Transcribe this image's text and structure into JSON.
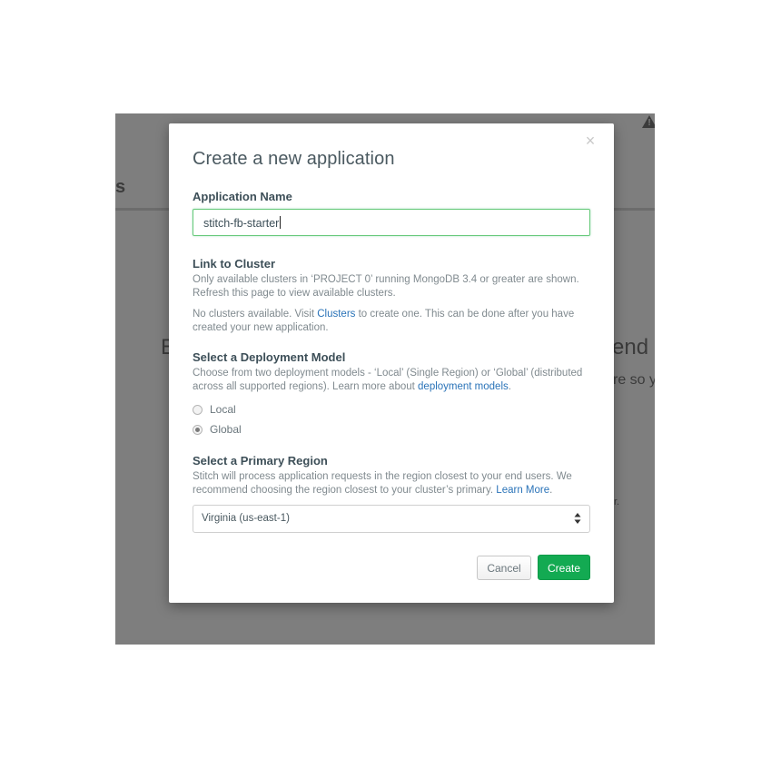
{
  "background": {
    "fragment_s": "s",
    "fragment_b": "E",
    "fragment_end": "end a",
    "fragment_so": "re so y",
    "fragment_r": "r."
  },
  "modal": {
    "close_symbol": "×",
    "title": "Create a new application",
    "app_name": {
      "label": "Application Name",
      "value": "stitch-fb-starter"
    },
    "cluster": {
      "label": "Link to Cluster",
      "help": "Only available clusters in ‘PROJECT 0’ running MongoDB 3.4 or greater are shown.  Refresh this page to view available clusters.",
      "note_before": "No clusters available. Visit ",
      "note_link": "Clusters",
      "note_after": " to create one. This can be done after you have created your new application."
    },
    "deployment": {
      "label": "Select a Deployment Model",
      "help_before": "Choose from two deployment models - ‘Local’ (Single Region) or ‘Global’ (distributed across all supported regions). Learn more about ",
      "help_link": "deployment models",
      "help_after": ".",
      "options": [
        {
          "label": "Local",
          "checked": false
        },
        {
          "label": "Global",
          "checked": true
        }
      ]
    },
    "region": {
      "label": "Select a Primary Region",
      "help_before": "Stitch will process application requests in the region closest to your end users.  We recommend choosing the region closest to your cluster’s primary. ",
      "help_link": "Learn More",
      "help_after": ".",
      "selected": "Virginia (us-east-1)"
    },
    "buttons": {
      "cancel": "Cancel",
      "create": "Create"
    }
  },
  "colors": {
    "accent_green": "#13aa52",
    "link_blue": "#2a73b8",
    "overlay": "#7e7e7e"
  }
}
